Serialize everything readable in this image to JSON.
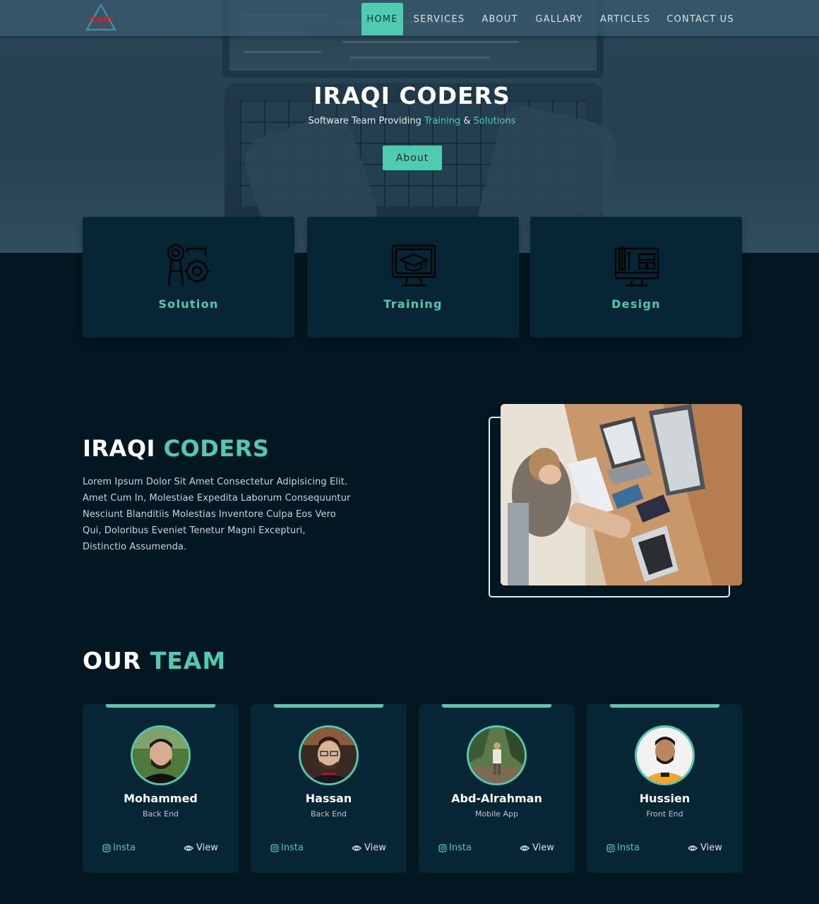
{
  "brand": {
    "logo_icon": "triangle-logo-icon",
    "logo_text": "iraqi",
    "logo_subtext": "coders",
    "accent_color": "#4fcbaf",
    "background_color": "#021722",
    "card_color": "#062535"
  },
  "nav": {
    "items": [
      {
        "label": "HOME",
        "active": true
      },
      {
        "label": "SERVICES",
        "active": false
      },
      {
        "label": "ABOUT",
        "active": false
      },
      {
        "label": "GALLARY",
        "active": false
      },
      {
        "label": "ARTICLES",
        "active": false
      },
      {
        "label": "CONTACT US",
        "active": false
      }
    ]
  },
  "hero": {
    "title": "IRAQI CODERS",
    "subtitle_prefix": "Software Team Providing ",
    "subtitle_highlight_1": "Training",
    "subtitle_joiner": " & ",
    "subtitle_highlight_2": "Solutions",
    "button_label": "About"
  },
  "services": [
    {
      "label": "Solution",
      "icon": "gear-lightbulb-icon"
    },
    {
      "label": "Training",
      "icon": "graduation-monitor-icon"
    },
    {
      "label": "Design",
      "icon": "design-monitor-icon"
    }
  ],
  "about": {
    "title_main": "IRAQI ",
    "title_accent": "CODERS",
    "text": "Lorem Ipsum Dolor Sit Amet Consectetur Adipisicing Elit. Amet Cum In, Molestiae Expedita Laborum Consequuntur Nesciunt Blanditiis Molestias Inventore Culpa Eos Vero Qui, Doloribus Eveniet Tenetur Magni Excepturi, Distinctio Assumenda."
  },
  "team": {
    "title_main": "OUR ",
    "title_accent": "TEAM",
    "members": [
      {
        "name": "Mohammed",
        "role": "Back End",
        "insta_label": "Insta",
        "view_label": "View"
      },
      {
        "name": "Hassan",
        "role": "Back End",
        "insta_label": "Insta",
        "view_label": "View"
      },
      {
        "name": "Abd-Alrahman",
        "role": "Mobile App",
        "insta_label": "Insta",
        "view_label": "View"
      },
      {
        "name": "Hussien",
        "role": "Front End",
        "insta_label": "Insta",
        "view_label": "View"
      }
    ]
  }
}
